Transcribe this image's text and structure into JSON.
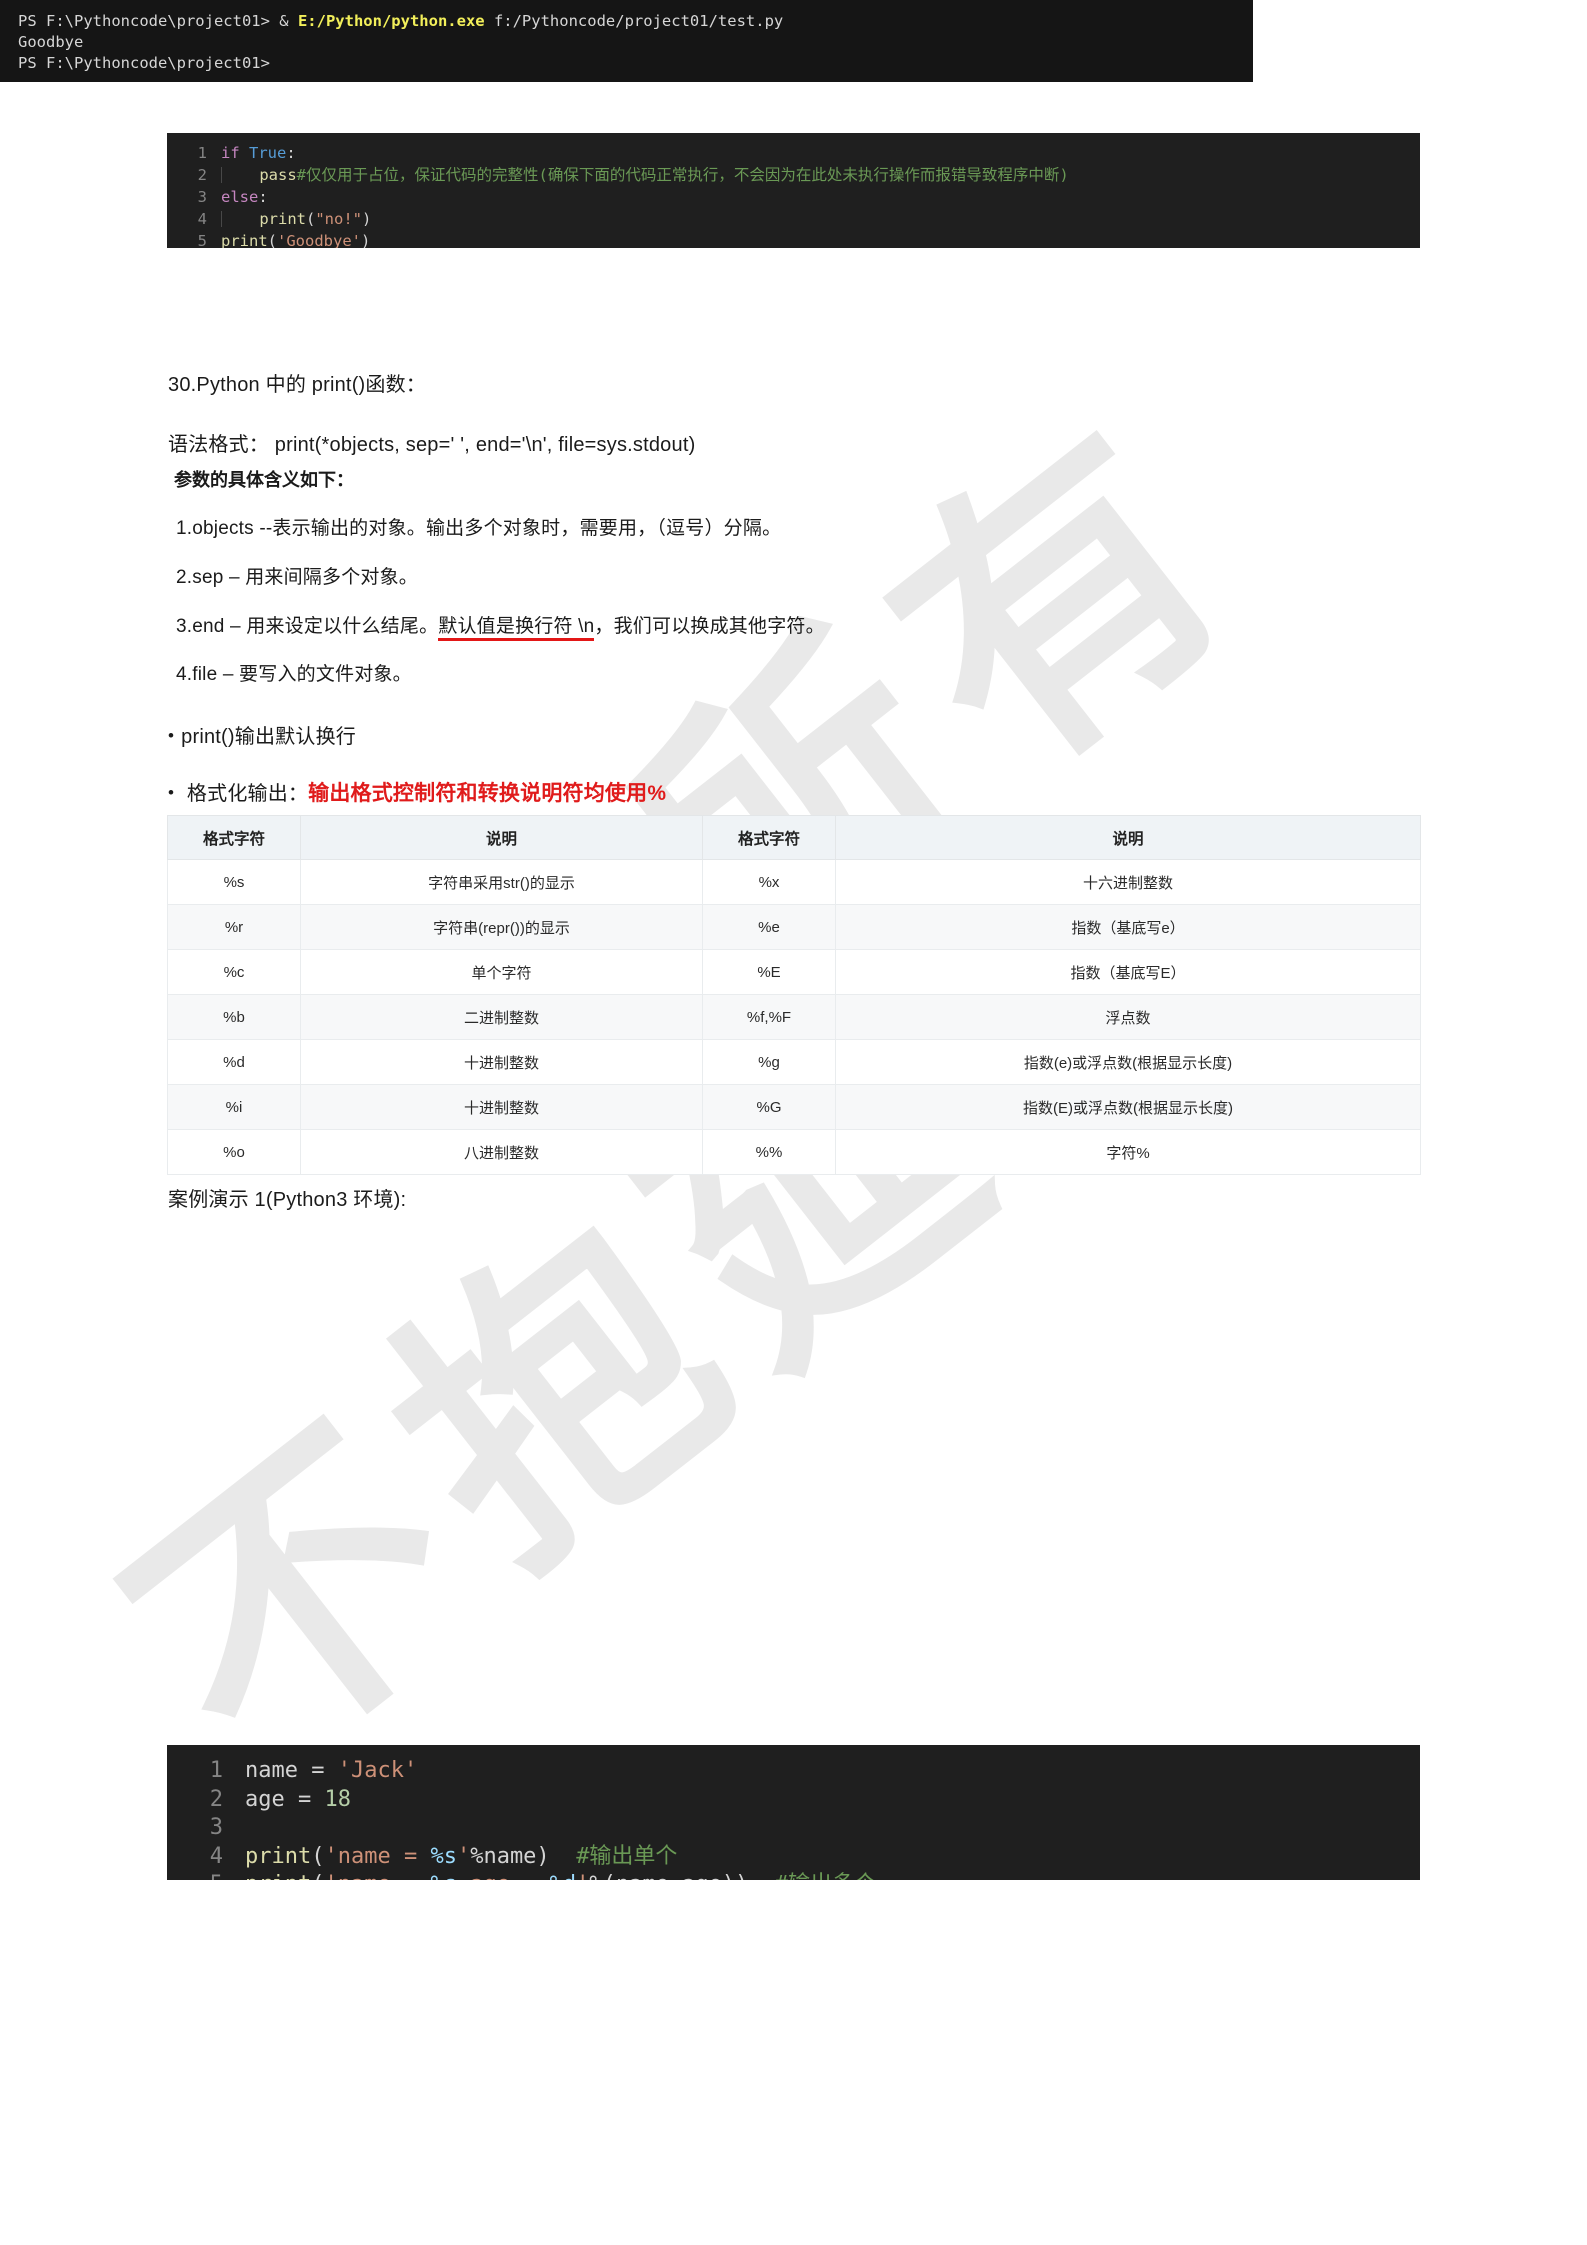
{
  "watermark": {
    "line_a": "权所有",
    "line_b": "不抱延"
  },
  "code_block_1": {
    "name": "python-if-else-snippet",
    "lines": [
      {
        "number": "1",
        "indent": 0,
        "tokens": [
          {
            "t": "if ",
            "c": "kw"
          },
          {
            "t": "True",
            "c": "bool"
          },
          {
            "t": ":",
            "c": "pun"
          }
        ]
      },
      {
        "number": "2",
        "indent": 1,
        "tokens": [
          {
            "t": "pass",
            "c": "fn"
          },
          {
            "t": "#仅仅用于占位，保证代码的完整性(确保下面的代码正常执行，不会因为在此处未执行操作而报错导致程序中断)",
            "c": "cmt"
          }
        ]
      },
      {
        "number": "3",
        "indent": 0,
        "tokens": [
          {
            "t": "else",
            "c": "kw"
          },
          {
            "t": ":",
            "c": "pun"
          }
        ]
      },
      {
        "number": "4",
        "indent": 1,
        "tokens": [
          {
            "t": "print",
            "c": "fn"
          },
          {
            "t": "(",
            "c": "pun"
          },
          {
            "t": "\"no!\"",
            "c": "str"
          },
          {
            "t": ")",
            "c": "pun"
          }
        ]
      },
      {
        "number": "5",
        "indent": 0,
        "tokens": [
          {
            "t": "print",
            "c": "fn"
          },
          {
            "t": "(",
            "c": "pun"
          },
          {
            "t": "'Goodbye'",
            "c": "str"
          },
          {
            "t": ")",
            "c": "pun"
          }
        ]
      }
    ]
  },
  "terminal": {
    "name": "powershell-output",
    "lines": [
      {
        "segments": [
          {
            "t": "PS F:\\Pythoncode\\project01> & ",
            "c": "term-amp"
          },
          {
            "t": "E:/Python/python.exe",
            "c": "term-hl"
          },
          {
            "t": " f:/Pythoncode/project01/test.py",
            "c": "term-amp"
          }
        ]
      },
      {
        "segments": [
          {
            "t": "Goodbye",
            "c": "term-amp"
          }
        ]
      },
      {
        "segments": [
          {
            "t": "PS F:\\Pythoncode\\project01>",
            "c": "term-amp"
          }
        ]
      }
    ]
  },
  "body": {
    "heading_30": "30.Python 中的 print()函数：",
    "syntax_line": "语法格式： print(*objects, sep=' ', end='\\n', file=sys.stdout)",
    "params_title": "参数的具体含义如下：",
    "param_1": "1.objects --表示输出的对象。输出多个对象时，需要用，（逗号）分隔。",
    "param_2": "2.sep – 用来间隔多个对象。",
    "param_3_pre": "3.end – 用来设定以什么结尾。",
    "param_3_underline": "默认值是换行符 \\n",
    "param_3_post": "，我们可以换成其他字符。",
    "param_4": "4.file – 要写入的文件对象。",
    "bullet_1": "print()输出默认换行",
    "bullet_2_pre": "格式化输出：",
    "bullet_2_red": "输出格式控制符和转换说明符均使用%",
    "case_title": "案例演示 1(Python3 环境):"
  },
  "format_table": {
    "name": "format-specifier-table",
    "headers": [
      "格式字符",
      "说明",
      "格式字符",
      "说明"
    ],
    "rows": [
      [
        "%s",
        "字符串采用str()的显示",
        "%x",
        "十六进制整数"
      ],
      [
        "%r",
        "字符串(repr())的显示",
        "%e",
        "指数（基底写e）"
      ],
      [
        "%c",
        "单个字符",
        "%E",
        "指数（基底写E）"
      ],
      [
        "%b",
        "二进制整数",
        "%f,%F",
        "浮点数"
      ],
      [
        "%d",
        "十进制整数",
        "%g",
        "指数(e)或浮点数(根据显示长度)"
      ],
      [
        "%i",
        "十进制整数",
        "%G",
        "指数(E)或浮点数(根据显示长度)"
      ],
      [
        "%o",
        "八进制整数",
        "%%",
        "字符%"
      ]
    ]
  },
  "code_block_2": {
    "name": "python-format-example-snippet",
    "lines": [
      {
        "number": "1",
        "indent": 0,
        "tokens": [
          {
            "t": "name ",
            "c": "pun"
          },
          {
            "t": "= ",
            "c": "op"
          },
          {
            "t": "'Jack'",
            "c": "str"
          }
        ]
      },
      {
        "number": "2",
        "indent": 0,
        "tokens": [
          {
            "t": "age ",
            "c": "pun"
          },
          {
            "t": "= ",
            "c": "op"
          },
          {
            "t": "18",
            "c": "num"
          }
        ]
      },
      {
        "number": "3",
        "indent": 0,
        "tokens": []
      },
      {
        "number": "4",
        "indent": 0,
        "tokens": [
          {
            "t": "print",
            "c": "fn"
          },
          {
            "t": "(",
            "c": "pun"
          },
          {
            "t": "'name = ",
            "c": "str"
          },
          {
            "t": "%s",
            "c": "var"
          },
          {
            "t": "'",
            "c": "str"
          },
          {
            "t": "%name)",
            "c": "pun"
          },
          {
            "t": "  ",
            "c": "pun"
          },
          {
            "t": "#输出单个",
            "c": "cmt"
          }
        ]
      },
      {
        "number": "5",
        "indent": 0,
        "tokens": [
          {
            "t": "print",
            "c": "fn"
          },
          {
            "t": "(",
            "c": "pun"
          },
          {
            "t": "'name = ",
            "c": "str"
          },
          {
            "t": "%s",
            "c": "var"
          },
          {
            "t": ",age = ",
            "c": "str"
          },
          {
            "t": "%d",
            "c": "var"
          },
          {
            "t": "'",
            "c": "str"
          },
          {
            "t": "%(name,age))",
            "c": "pun"
          },
          {
            "t": "  ",
            "c": "pun"
          },
          {
            "t": "#输出多个",
            "c": "cmt"
          }
        ]
      }
    ]
  }
}
